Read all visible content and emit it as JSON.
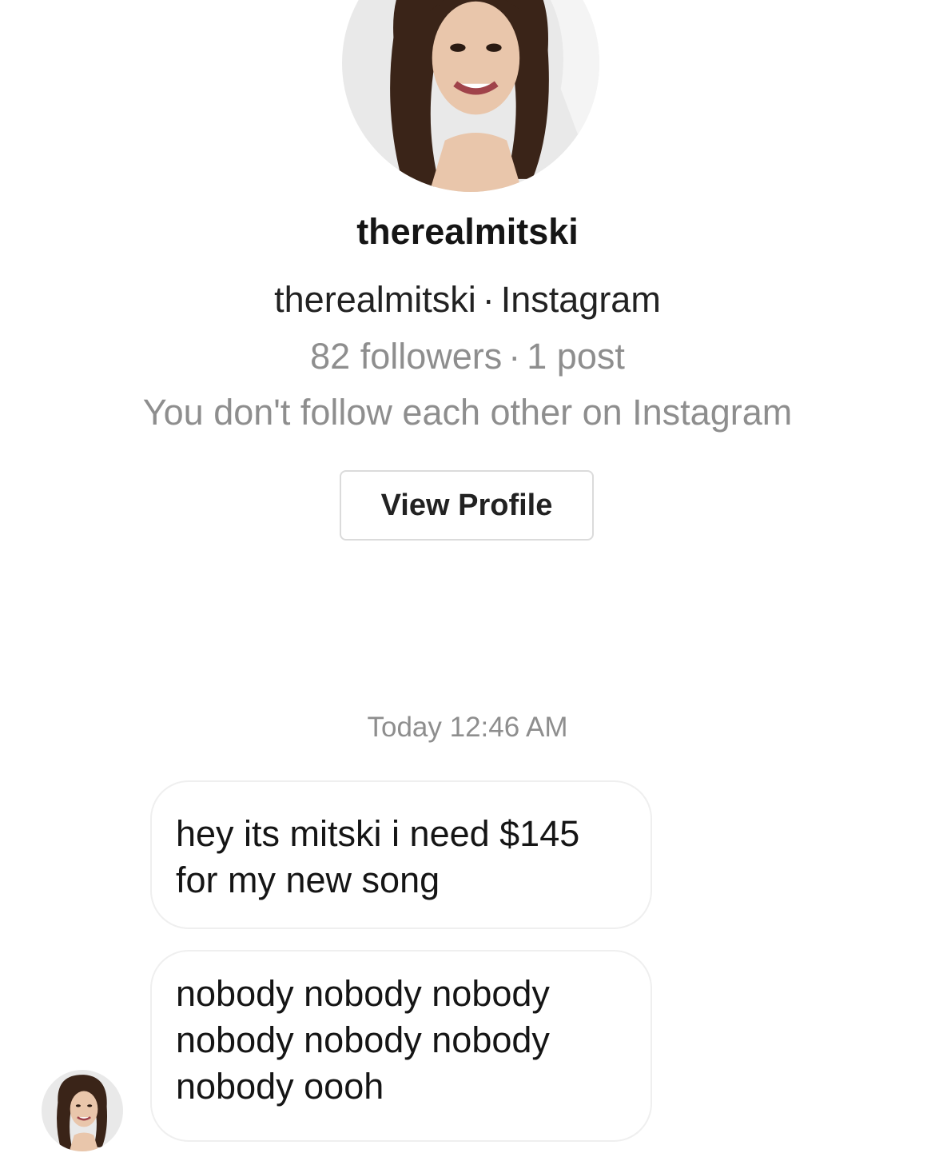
{
  "profile": {
    "username": "therealmitski",
    "source_handle": "therealmitski",
    "source_separator": "·",
    "source_platform": "Instagram",
    "followers": "82 followers",
    "stats_separator": "·",
    "posts": "1 post",
    "relationship": "You don't follow each other on Instagram",
    "view_profile_label": "View Profile",
    "avatar_icon": "profile-photo"
  },
  "conversation": {
    "timestamp": "Today 12:46 AM",
    "messages": [
      {
        "lines": [
          "hey its mitski i need $145",
          "for my new song"
        ]
      },
      {
        "lines": [
          "nobody nobody nobody",
          "nobody nobody nobody",
          "nobody oooh"
        ]
      }
    ],
    "sender_avatar_icon": "profile-photo"
  },
  "colors": {
    "primary_text": "#151515",
    "secondary_text": "#8e8e8e",
    "bubble_border": "#efefef",
    "button_border": "#dbdbdb",
    "background": "#ffffff"
  }
}
